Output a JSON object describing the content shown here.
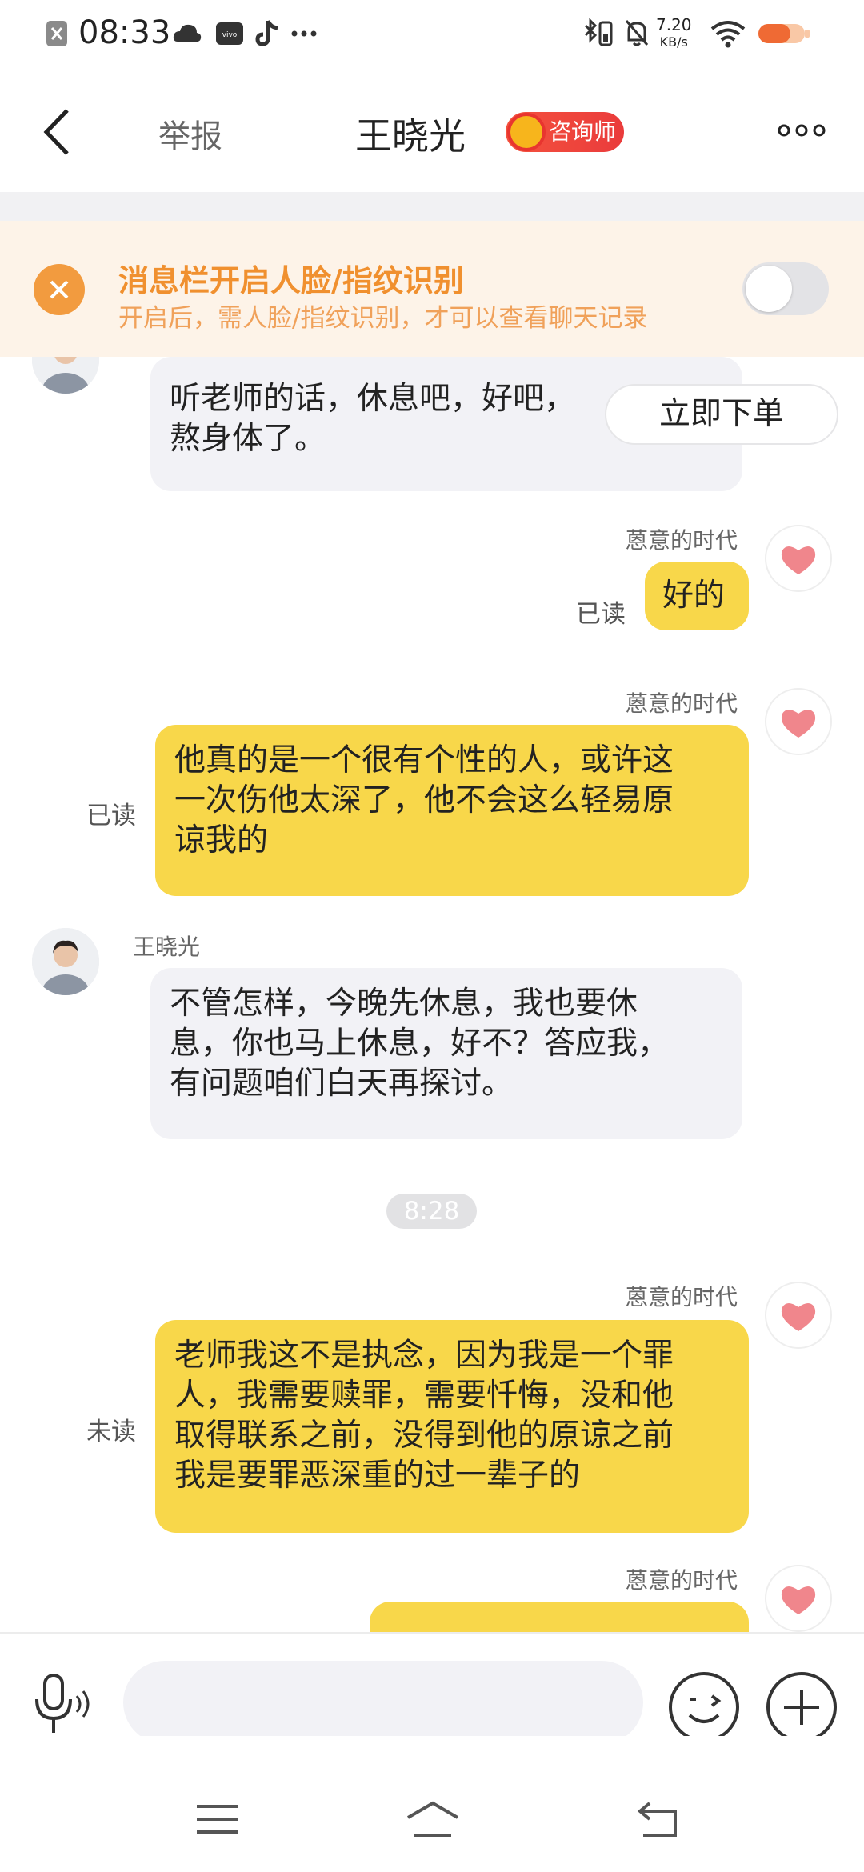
{
  "status_bar": {
    "time": "08:33",
    "net_speed_value": "7.20",
    "net_speed_unit": "KB/s"
  },
  "nav": {
    "back_icon": "chevron-left-icon",
    "report_label": "举报",
    "title": "王晓光",
    "badge_label": "咨询师",
    "more_icon": "more-dots-icon"
  },
  "banner": {
    "title": "消息栏开启人脸/指纹识别",
    "subtitle": "开启后，需人脸/指纹识别，才可以查看聊天记录",
    "toggle_on": false
  },
  "chat": {
    "order_button": "立即下单",
    "time_divider": "8:28",
    "messages": [
      {
        "side": "left",
        "sender": "",
        "text_lines": [
          "听老师的话，休息吧，好吧，",
          "熬身体了。"
        ]
      },
      {
        "side": "right",
        "sender": "蒽意的时代",
        "status": "已读",
        "text_lines": [
          "好的"
        ]
      },
      {
        "side": "right",
        "sender": "蒽意的时代",
        "status": "已读",
        "text_lines": [
          "他真的是一个很有个性的人，或许这",
          "一次伤他太深了，他不会这么轻易原",
          "谅我的"
        ]
      },
      {
        "side": "left",
        "sender": "王晓光",
        "text_lines": [
          "不管怎样，今晚先休息，我也要休",
          "息，你也马上休息，好不？答应我，",
          "有问题咱们白天再探讨。"
        ]
      },
      {
        "side": "right",
        "sender": "蒽意的时代",
        "status": "未读",
        "text_lines": [
          "老师我这不是执念，因为我是一个罪",
          "人，我需要赎罪，需要忏悔，没和他",
          "取得联系之前，没得到他的原谅之前",
          "我是要罪恶深重的过一辈子的"
        ]
      },
      {
        "side": "right",
        "sender": "蒽意的时代",
        "status": "",
        "text_lines": []
      }
    ]
  },
  "colors": {
    "accent_yellow": "#f8d74a",
    "banner_orange": "#f0902f",
    "badge_red": "#ea3b3b"
  }
}
